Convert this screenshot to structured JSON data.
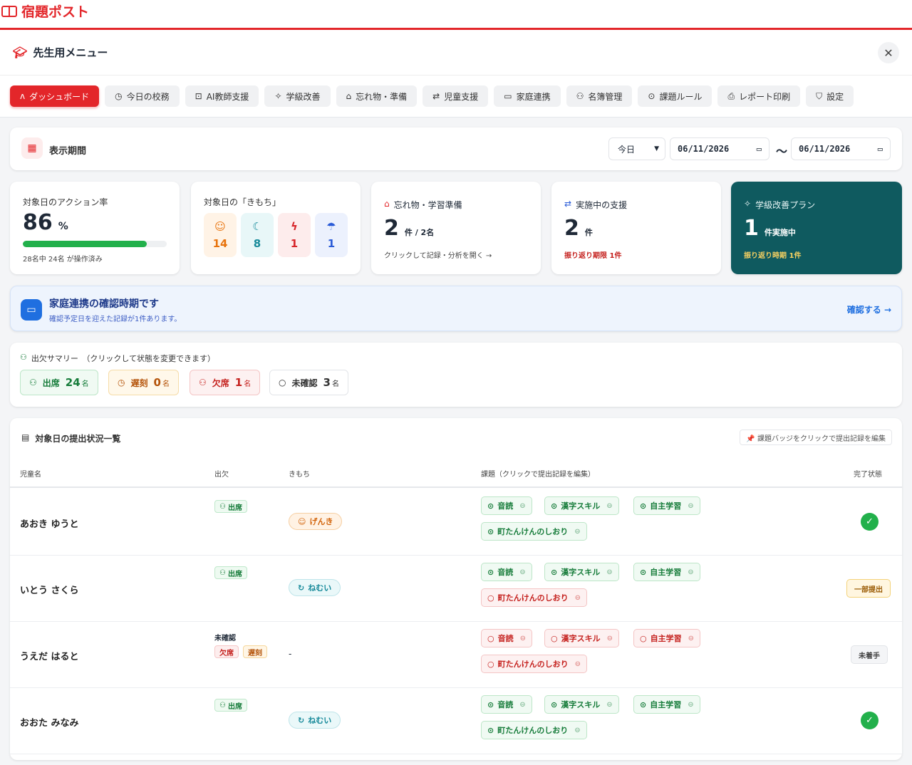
{
  "app": {
    "title": "宿題ポスト"
  },
  "menu": {
    "title": "先生用メニュー",
    "close": "✕"
  },
  "tabs": [
    {
      "icon": "ʌ",
      "label": "ダッシュボード",
      "active": true
    },
    {
      "icon": "◷",
      "label": "今日の校務"
    },
    {
      "icon": "⊡",
      "label": "AI教師支援"
    },
    {
      "icon": "✧",
      "label": "学級改善"
    },
    {
      "icon": "⌂",
      "label": "忘れ物・準備"
    },
    {
      "icon": "⇄",
      "label": "児童支援"
    },
    {
      "icon": "▭",
      "label": "家庭連携"
    },
    {
      "icon": "⚇",
      "label": "名簿管理"
    },
    {
      "icon": "⊙",
      "label": "課題ルール"
    },
    {
      "icon": "⎙",
      "label": "レポート印刷"
    },
    {
      "icon": "⛉",
      "label": "設定"
    }
  ],
  "period": {
    "label": "表示期間",
    "select": "今日",
    "from": "06/11/2026",
    "tilde": "〜",
    "to": "06/11/2026"
  },
  "stats": {
    "action": {
      "title": "対象日のアクション率",
      "value": "86",
      "unit": "%",
      "progress": 0.86,
      "sub": "28名中 24名 が操作済み"
    },
    "mood": {
      "title": "対象日の「きもち」",
      "items": [
        {
          "icon": "☺",
          "count": "14",
          "color": "#e8730c",
          "bg": "#fff3e6"
        },
        {
          "icon": "☾",
          "count": "8",
          "color": "#178a9a",
          "bg": "#e8f7f8"
        },
        {
          "icon": "ϟ",
          "count": "1",
          "color": "#d7262b",
          "bg": "#fdecec"
        },
        {
          "icon": "☂",
          "count": "1",
          "color": "#2a5bd7",
          "bg": "#ecf1fd"
        }
      ]
    },
    "forgot": {
      "icon": "⌂",
      "title": "忘れ物・学習準備",
      "value": "2",
      "unit": "件 / 2名",
      "sub": "クリックして記録・分析を開く →"
    },
    "support": {
      "icon": "⇄",
      "title": "実施中の支援",
      "value": "2",
      "unit": "件",
      "sub": "振り返り期限 1件"
    },
    "plan": {
      "icon": "✧",
      "title": "学級改善プラン",
      "value": "1",
      "unit": "件実施中",
      "sub": "振り返り時期 1件"
    }
  },
  "alert": {
    "icon": "▭",
    "title": "家庭連携の確認時期です",
    "sub": "確認予定日を迎えた記録が1件あります。",
    "link": "確認する →"
  },
  "attendance": {
    "title": "出欠サマリー　（クリックして状態を変更できます）",
    "pills": [
      {
        "icon": "⚇",
        "label": "出席",
        "count": "24",
        "unit": "名",
        "color": "#167c3a",
        "bg": "#f0faf3",
        "border": "#bde6c8"
      },
      {
        "icon": "◷",
        "label": "遅刻",
        "count": "0",
        "unit": "名",
        "color": "#b45309",
        "bg": "#fff8ea",
        "border": "#f6dca8"
      },
      {
        "icon": "⚇",
        "label": "欠席",
        "count": "1",
        "unit": "名",
        "color": "#c5221f",
        "bg": "#fdf1f1",
        "border": "#f4c5c5"
      },
      {
        "icon": "○",
        "label": "未確認",
        "count": "3",
        "unit": "名",
        "color": "#333333",
        "bg": "#ffffff",
        "border": "#e2e4e8"
      }
    ]
  },
  "list": {
    "title": "対象日の提出状況一覧",
    "hint": "📌 課題バッジをクリックで提出記録を編集",
    "columns": {
      "name": "児童名",
      "attendance": "出欠",
      "mood": "きもち",
      "tasks": "課題（クリックで提出記録を編集）",
      "status": "完了状態"
    },
    "rows": [
      {
        "name": "あおき ゆうと",
        "att": "出席",
        "mood": "げんき",
        "moodIcon": "☺",
        "moodType": "genki",
        "tasks": [
          {
            "label": "音読",
            "ok": true
          },
          {
            "label": "漢字スキル",
            "ok": true
          },
          {
            "label": "自主学習",
            "ok": true
          },
          {
            "label": "町たんけんのしおり",
            "ok": true
          }
        ],
        "status": "done",
        "statusIcon": "✓"
      },
      {
        "name": "いとう さくら",
        "att": "出席",
        "mood": "ねむい",
        "moodIcon": "↻",
        "moodType": "nemui",
        "tasks": [
          {
            "label": "音読",
            "ok": true
          },
          {
            "label": "漢字スキル",
            "ok": true
          },
          {
            "label": "自主学習",
            "ok": true
          },
          {
            "label": "町たんけんのしおり",
            "ok": false
          }
        ],
        "status": "partial",
        "statusLabel": "一部提出"
      },
      {
        "name": "うえだ はると",
        "attUnconfirmed": "未確認",
        "attAbsent": "欠席",
        "attLate": "遅刻",
        "mood": "-",
        "tasks": [
          {
            "label": "音読",
            "ok": false
          },
          {
            "label": "漢字スキル",
            "ok": false
          },
          {
            "label": "自主学習",
            "ok": false
          },
          {
            "label": "町たんけんのしおり",
            "ok": false
          }
        ],
        "status": "notstarted",
        "statusLabel": "未着手"
      },
      {
        "name": "おおた みなみ",
        "att": "出席",
        "mood": "ねむい",
        "moodIcon": "↻",
        "moodType": "nemui",
        "tasks": [
          {
            "label": "音読",
            "ok": true
          },
          {
            "label": "漢字スキル",
            "ok": true
          },
          {
            "label": "自主学習",
            "ok": true
          },
          {
            "label": "町たんけんのしおり",
            "ok": true
          }
        ],
        "status": "done",
        "statusIcon": "✓"
      }
    ]
  },
  "colors": {
    "brand": "#e3262a",
    "plan": "#0f5a5f",
    "planAccent": "#f5d061",
    "success": "#22b04b"
  }
}
